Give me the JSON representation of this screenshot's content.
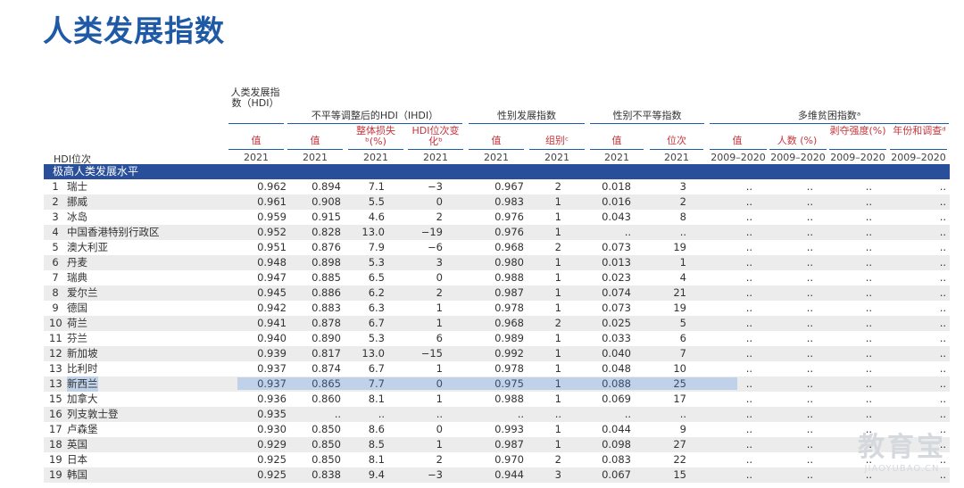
{
  "title": "人类发展指数",
  "headers": {
    "hdi": "人类发展指数（HDI）",
    "ihdi": "不平等调整后的HDI（IHDI）",
    "gdi": "性别发展指数",
    "gii": "性别不平等指数",
    "mpi": "多维贫困指数ᵃ",
    "sub_value": "值",
    "sub_loss": "整体损失ᵇ(%)",
    "sub_rank_change": "HDI位次变化ᵇ",
    "sub_group": "组别ᶜ",
    "sub_rank": "位次",
    "sub_people": "人数 (%)",
    "sub_intensity": "剥夺强度(%)",
    "sub_year": "年份和调查ᵈ",
    "hdi_rank": "HDI位次",
    "year_2021": "2021",
    "year_range": "2009–2020"
  },
  "section": "极高人类发展水平",
  "rows": [
    {
      "rank": "1",
      "name": "瑞士",
      "hdi": "0.962",
      "ihdi": "0.894",
      "loss": "7.1",
      "chg": "−3",
      "gdi": "0.967",
      "grp": "2",
      "gii": "0.018",
      "giir": "3",
      "mv": "..",
      "mp": "..",
      "mi": "..",
      "my": ".."
    },
    {
      "rank": "2",
      "name": "挪威",
      "hdi": "0.961",
      "ihdi": "0.908",
      "loss": "5.5",
      "chg": "0",
      "gdi": "0.983",
      "grp": "1",
      "gii": "0.016",
      "giir": "2",
      "mv": "..",
      "mp": "..",
      "mi": "..",
      "my": ".."
    },
    {
      "rank": "3",
      "name": "冰岛",
      "hdi": "0.959",
      "ihdi": "0.915",
      "loss": "4.6",
      "chg": "2",
      "gdi": "0.976",
      "grp": "1",
      "gii": "0.043",
      "giir": "8",
      "mv": "..",
      "mp": "..",
      "mi": "..",
      "my": ".."
    },
    {
      "rank": "4",
      "name": "中国香港特别行政区",
      "hdi": "0.952",
      "ihdi": "0.828",
      "loss": "13.0",
      "chg": "−19",
      "gdi": "0.976",
      "grp": "1",
      "gii": "..",
      "giir": "..",
      "mv": "..",
      "mp": "..",
      "mi": "..",
      "my": ".."
    },
    {
      "rank": "5",
      "name": "澳大利亚",
      "hdi": "0.951",
      "ihdi": "0.876",
      "loss": "7.9",
      "chg": "−6",
      "gdi": "0.968",
      "grp": "2",
      "gii": "0.073",
      "giir": "19",
      "mv": "..",
      "mp": "..",
      "mi": "..",
      "my": ".."
    },
    {
      "rank": "6",
      "name": "丹麦",
      "hdi": "0.948",
      "ihdi": "0.898",
      "loss": "5.3",
      "chg": "3",
      "gdi": "0.980",
      "grp": "1",
      "gii": "0.013",
      "giir": "1",
      "mv": "..",
      "mp": "..",
      "mi": "..",
      "my": ".."
    },
    {
      "rank": "7",
      "name": "瑞典",
      "hdi": "0.947",
      "ihdi": "0.885",
      "loss": "6.5",
      "chg": "0",
      "gdi": "0.988",
      "grp": "1",
      "gii": "0.023",
      "giir": "4",
      "mv": "..",
      "mp": "..",
      "mi": "..",
      "my": ".."
    },
    {
      "rank": "8",
      "name": "爱尔兰",
      "hdi": "0.945",
      "ihdi": "0.886",
      "loss": "6.2",
      "chg": "2",
      "gdi": "0.987",
      "grp": "1",
      "gii": "0.074",
      "giir": "21",
      "mv": "..",
      "mp": "..",
      "mi": "..",
      "my": ".."
    },
    {
      "rank": "9",
      "name": "德国",
      "hdi": "0.942",
      "ihdi": "0.883",
      "loss": "6.3",
      "chg": "1",
      "gdi": "0.978",
      "grp": "1",
      "gii": "0.073",
      "giir": "19",
      "mv": "..",
      "mp": "..",
      "mi": "..",
      "my": ".."
    },
    {
      "rank": "10",
      "name": "荷兰",
      "hdi": "0.941",
      "ihdi": "0.878",
      "loss": "6.7",
      "chg": "1",
      "gdi": "0.968",
      "grp": "2",
      "gii": "0.025",
      "giir": "5",
      "mv": "..",
      "mp": "..",
      "mi": "..",
      "my": ".."
    },
    {
      "rank": "11",
      "name": "芬兰",
      "hdi": "0.940",
      "ihdi": "0.890",
      "loss": "5.3",
      "chg": "6",
      "gdi": "0.989",
      "grp": "1",
      "gii": "0.033",
      "giir": "6",
      "mv": "..",
      "mp": "..",
      "mi": "..",
      "my": ".."
    },
    {
      "rank": "12",
      "name": "新加坡",
      "hdi": "0.939",
      "ihdi": "0.817",
      "loss": "13.0",
      "chg": "−15",
      "gdi": "0.992",
      "grp": "1",
      "gii": "0.040",
      "giir": "7",
      "mv": "..",
      "mp": "..",
      "mi": "..",
      "my": ".."
    },
    {
      "rank": "13",
      "name": "比利时",
      "hdi": "0.937",
      "ihdi": "0.874",
      "loss": "6.7",
      "chg": "1",
      "gdi": "0.978",
      "grp": "1",
      "gii": "0.048",
      "giir": "10",
      "mv": "..",
      "mp": "..",
      "mi": "..",
      "my": ".."
    },
    {
      "rank": "13",
      "name": "新西兰",
      "hdi": "0.937",
      "ihdi": "0.865",
      "loss": "7.7",
      "chg": "0",
      "gdi": "0.975",
      "grp": "1",
      "gii": "0.088",
      "giir": "25",
      "mv": "..",
      "mp": "..",
      "mi": "..",
      "my": "..",
      "highlight": true
    },
    {
      "rank": "15",
      "name": "加拿大",
      "hdi": "0.936",
      "ihdi": "0.860",
      "loss": "8.1",
      "chg": "1",
      "gdi": "0.988",
      "grp": "1",
      "gii": "0.069",
      "giir": "17",
      "mv": "..",
      "mp": "..",
      "mi": "..",
      "my": ".."
    },
    {
      "rank": "16",
      "name": "列支敦士登",
      "hdi": "0.935",
      "ihdi": "..",
      "loss": "..",
      "chg": "..",
      "gdi": "..",
      "grp": "..",
      "gii": "..",
      "giir": "..",
      "mv": "..",
      "mp": "..",
      "mi": "..",
      "my": ".."
    },
    {
      "rank": "17",
      "name": "卢森堡",
      "hdi": "0.930",
      "ihdi": "0.850",
      "loss": "8.6",
      "chg": "0",
      "gdi": "0.993",
      "grp": "1",
      "gii": "0.044",
      "giir": "9",
      "mv": "..",
      "mp": "..",
      "mi": "..",
      "my": ".."
    },
    {
      "rank": "18",
      "name": "英国",
      "hdi": "0.929",
      "ihdi": "0.850",
      "loss": "8.5",
      "chg": "1",
      "gdi": "0.987",
      "grp": "1",
      "gii": "0.098",
      "giir": "27",
      "mv": "..",
      "mp": "..",
      "mi": "..",
      "my": ".."
    },
    {
      "rank": "19",
      "name": "日本",
      "hdi": "0.925",
      "ihdi": "0.850",
      "loss": "8.1",
      "chg": "2",
      "gdi": "0.970",
      "grp": "2",
      "gii": "0.083",
      "giir": "22",
      "mv": "..",
      "mp": "..",
      "mi": "..",
      "my": ".."
    },
    {
      "rank": "19",
      "name": "韩国",
      "hdi": "0.925",
      "ihdi": "0.838",
      "loss": "9.4",
      "chg": "−3",
      "gdi": "0.944",
      "grp": "3",
      "gii": "0.067",
      "giir": "15",
      "mv": "..",
      "mp": "..",
      "mi": "..",
      "my": ".."
    }
  ],
  "watermark": {
    "big": "教育宝",
    "small": "JIAOYUBAO.CN"
  }
}
